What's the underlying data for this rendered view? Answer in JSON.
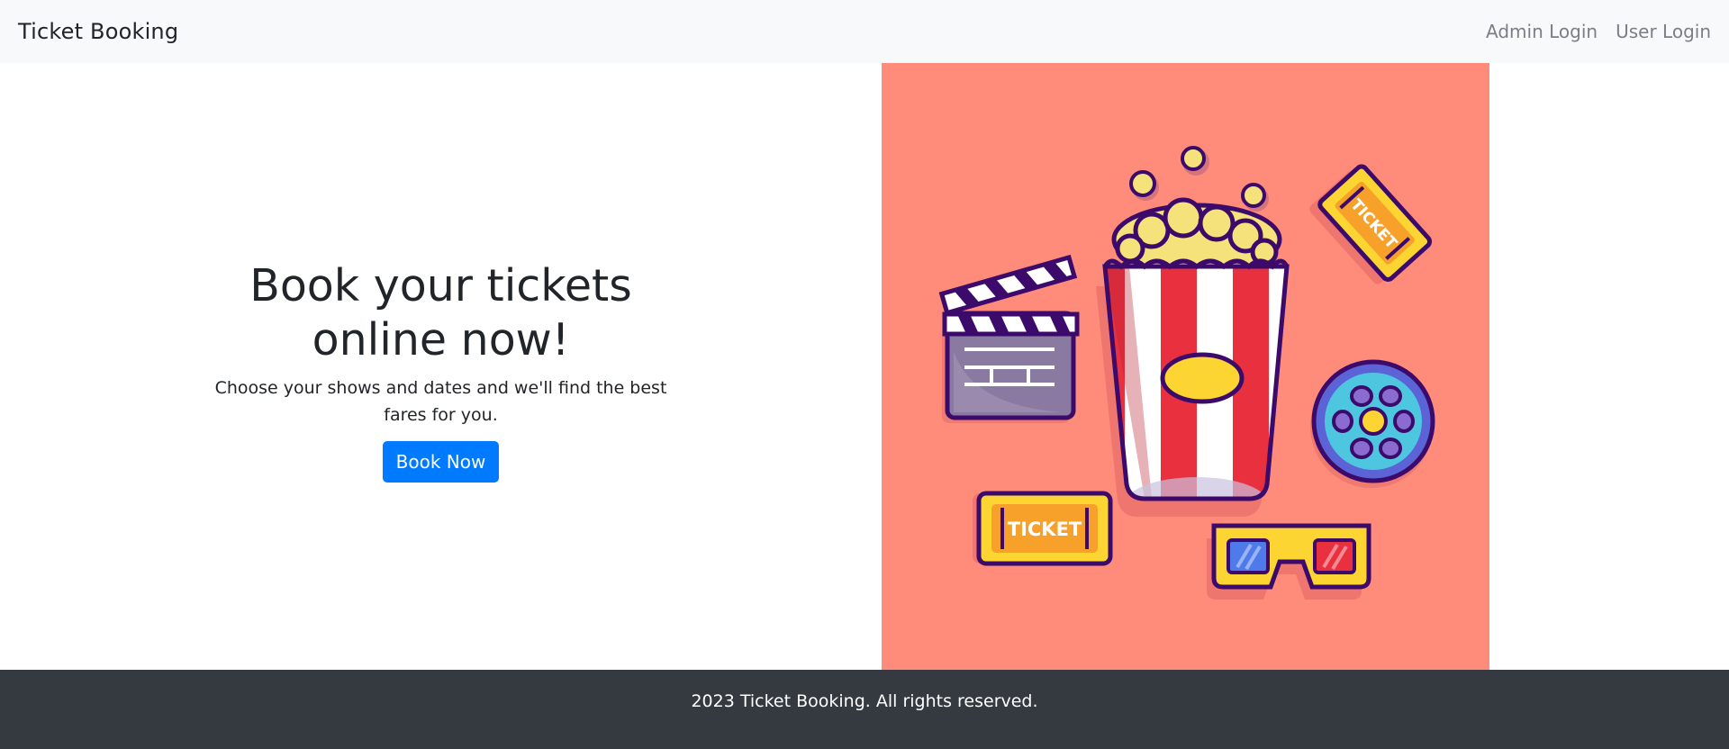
{
  "navbar": {
    "brand": "Ticket Booking",
    "links": [
      {
        "label": "Admin Login"
      },
      {
        "label": "User Login"
      }
    ]
  },
  "hero": {
    "title_line1": "Book your tickets",
    "title_line2": "online now!",
    "subtitle": "Choose your shows and dates and we'll find the best fares for you.",
    "cta_label": "Book Now"
  },
  "illustration": {
    "background_color": "#ff8c7a",
    "ticket_left_text": "TICKET",
    "ticket_right_text": "TICKET",
    "icons": [
      "clapperboard-icon",
      "popcorn-icon",
      "ticket-icon",
      "film-reel-icon",
      "3d-glasses-icon",
      "popcorn-kernel-icon"
    ]
  },
  "footer": {
    "text": "2023 Ticket Booking. All rights reserved."
  },
  "colors": {
    "navbar_bg": "#f8f9fa",
    "primary": "#007bff",
    "footer_bg": "#343a40",
    "outline": "#3b0a6b"
  }
}
